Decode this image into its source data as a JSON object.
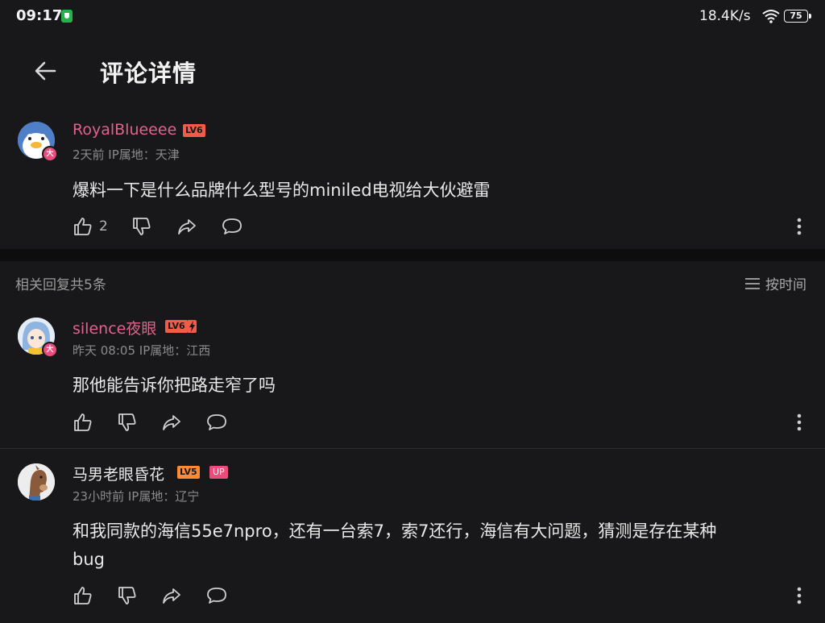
{
  "status_bar": {
    "time": "09:17",
    "net_speed": "18.4K/s",
    "battery": "75"
  },
  "header": {
    "title": "评论详情"
  },
  "main_comment": {
    "username": "RoyalBlueeee",
    "level": "LV6",
    "vip_badge": "大",
    "meta": "2天前 IP属地：天津",
    "content": "爆料一下是什么品牌什么型号的miniled电视给大伙避雷",
    "likes": "2"
  },
  "replies_bar": {
    "label": "相关回复共5条",
    "sort_label": "按时间"
  },
  "replies": [
    {
      "username": "silence夜眼",
      "level": "LV6",
      "vip_badge": "大",
      "meta": "昨天 08:05 IP属地：江西",
      "content": "那他能告诉你把路走窄了吗"
    },
    {
      "username": "马男老眼昏花",
      "level": "LV5",
      "up_badge": "UP",
      "meta": "23小时前 IP属地：辽宁",
      "content_line1": "和我同款的海信55e7npro，还有一台索7，索7还行，海信有大问题，猜测是存在某种",
      "content_line2": "bug"
    }
  ],
  "colors": {
    "username_pink": "#e0638c",
    "level6": "#f05c49",
    "level5": "#ff8a36",
    "up_badge": "#e84d7c",
    "background": "#18181a"
  }
}
